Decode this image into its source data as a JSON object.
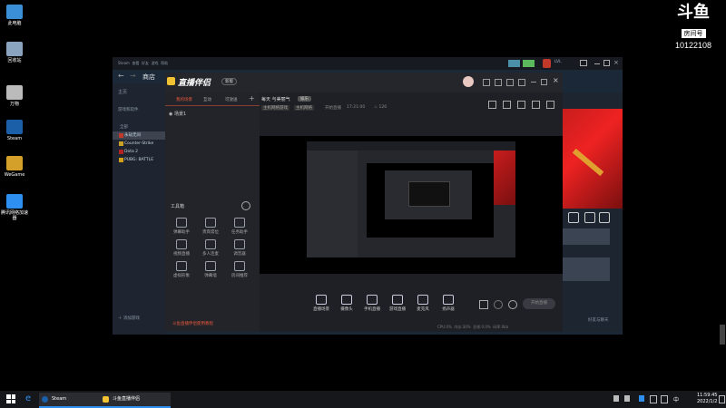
{
  "desktop": {
    "icons": [
      {
        "label": "此电脑",
        "icon": "computer-icon",
        "color": "#3b8fd9"
      },
      {
        "label": "回收站",
        "icon": "recycle-bin-icon",
        "color": "#8aa4c0"
      },
      {
        "label": "万物",
        "icon": "app-icon",
        "color": "#bbbbbb"
      },
      {
        "label": "Steam",
        "icon": "steam-icon",
        "color": "#1b5fa8"
      },
      {
        "label": "WeGame",
        "icon": "wegame-icon",
        "color": "#d4a02a"
      },
      {
        "label": "腾讯网络加速器",
        "icon": "accelerator-icon",
        "color": "#2f8ff0"
      }
    ]
  },
  "room_logo": {
    "mark": "斗鱼",
    "sub": "房间号",
    "room_number": "10122108"
  },
  "steam": {
    "menu": [
      "Steam",
      "查看",
      "好友",
      "游戏",
      "帮助"
    ],
    "nav_title": "商店",
    "home": "主页",
    "recent": "游戏和软件",
    "section": "全部",
    "games": [
      {
        "name": "永劫无间",
        "color": "#c0392b"
      },
      {
        "name": "Counter-Strike",
        "color": "#c9a227"
      },
      {
        "name": "Dota 2",
        "color": "#b22222"
      },
      {
        "name": "PUBG: BATTLE",
        "color": "#d4a017"
      }
    ],
    "add_game": "添加游戏",
    "friends": "好友与聊天",
    "badge": "LVL"
  },
  "streamer": {
    "app_name": "直播伴侣",
    "version_badge": "新版",
    "tabs": [
      "我的场景",
      "互动",
      "可放送"
    ],
    "scene_name": "场景1",
    "stream_title": "每天 与美丽气",
    "category_badge": "娱乐",
    "tags": [
      "主机网络游戏",
      "主机网络"
    ],
    "timestamp": "开始直播",
    "time_value": "17:21:00",
    "viewers": "126",
    "tools_title": "工具箱",
    "tools": [
      "弹幕助手",
      "贵宾席位",
      "任务助手",
      "视频直播",
      "多人连麦",
      "调音器",
      "虚拟形象",
      "弹幕墙",
      "房间推荐"
    ],
    "notice": "斗鱼直播伴侣使用教程",
    "bottom_actions": [
      "直播场景",
      "摄像头",
      "手机直播",
      "游戏直播",
      "麦克风",
      "扬声器"
    ],
    "start_button": "开始直播",
    "stats": [
      "CPU:0%",
      "内存:30%",
      "丢帧:0.0%",
      "码率:0kb"
    ]
  },
  "taskbar": {
    "items": [
      "Steam",
      "斗鱼直播伴侣"
    ],
    "time": "11:59:45",
    "date": "2022/1/2",
    "lang": "中"
  }
}
